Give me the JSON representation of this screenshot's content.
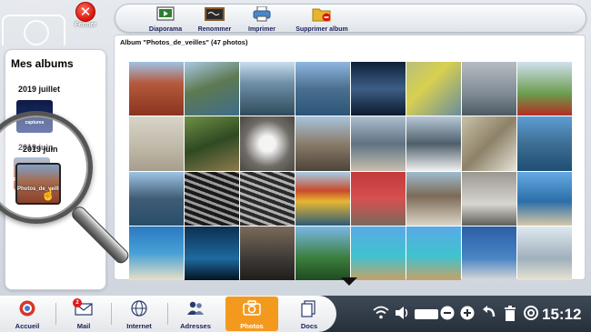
{
  "app": {
    "close_label": "Fermer"
  },
  "toolbar": {
    "buttons": [
      {
        "label": "Diaporama",
        "icon": "slideshow-icon"
      },
      {
        "label": "Renommer",
        "icon": "rename-board-icon"
      },
      {
        "label": "Imprimer",
        "icon": "printer-icon"
      },
      {
        "label": "Supprimer album",
        "icon": "delete-album-icon"
      }
    ]
  },
  "sidebar": {
    "title": "Mes albums",
    "albums": [
      {
        "label": "2019 juillet",
        "caption": "captures"
      },
      {
        "label": "2019 juin",
        "caption": "Photos_de_veilles"
      }
    ]
  },
  "album": {
    "title": "Album \"Photos_de_veilles\" (47 photos)",
    "photo_count": 47,
    "visible_photos": 32
  },
  "taskbar": {
    "items": [
      {
        "label": "Accueil",
        "icon": "home-icon"
      },
      {
        "label": "Mail",
        "icon": "mail-icon",
        "badge": "2"
      },
      {
        "label": "Internet",
        "icon": "globe-icon"
      },
      {
        "label": "Adresses",
        "icon": "contacts-icon"
      },
      {
        "label": "Photos",
        "icon": "camera-icon",
        "active": true
      },
      {
        "label": "Docs",
        "icon": "docs-icon"
      }
    ],
    "clock": "15:12",
    "accent": "#f39a1e"
  }
}
